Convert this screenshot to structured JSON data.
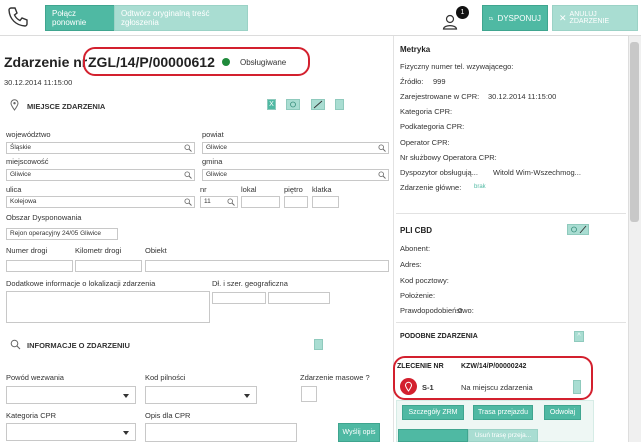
{
  "toolbar": {
    "reconnect_label": "Połącz ponownie",
    "play_original_label": "Odtwórz oryginalną treść zgłoszenia",
    "notifications_count": "1",
    "dispatch_label": "DYSPONUJ",
    "cancel_call_label": "ANULUJ ZDARZENIE"
  },
  "incident": {
    "title_prefix": "Zdarzenie nr",
    "number": "ZGL/14/P/00000612",
    "status": "Obsługiwane",
    "datetime": "30.12.2014 11:15:00"
  },
  "location": {
    "section_title": "MIEJSCE ZDARZENIA",
    "voivodeship_label": "województwo",
    "voivodeship_value": "Śląskie",
    "county_label": "powiat",
    "county_value": "Gliwice",
    "city_label": "miejscowość",
    "city_value": "Gliwice",
    "commune_label": "gmina",
    "commune_value": "Gliwice",
    "street_label": "ulica",
    "street_value": "Kolejowa",
    "number_label": "nr",
    "number_value": "11",
    "apartment_label": "lokal",
    "floor_label": "piętro",
    "stairwell_label": "klatka",
    "dispatch_area_label": "Obszar Dysponowania",
    "dispatch_area_value": "Rejon operacyjny 24/05 Gliwice",
    "road_number_label": "Numer drogi",
    "road_km_label": "Kilometr drogi",
    "object_label": "Obiekt",
    "extra_info_label": "Dodatkowe informacje o lokalizacji zdarzenia",
    "geo_label": "Dł. i szer. geograficzna"
  },
  "event_info": {
    "section_title": "INFORMACJE O ZDARZENIU",
    "reason_label": "Powód wezwania",
    "urgency_label": "Kod pilności",
    "mass_event_label": "Zdarzenie masowe ?",
    "cpr_category_label": "Kategoria CPR",
    "cpr_description_label": "Opis dla CPR",
    "send_description_label": "Wyślij opis"
  },
  "metrics": {
    "title": "Metryka",
    "phone_label": "Fizyczny numer tel. wzywającego:",
    "source_label": "Źródło:",
    "source_value": "999",
    "cpr_registered_label": "Zarejestrowane w CPR:",
    "cpr_registered_value": "30.12.2014 11:15:00",
    "cpr_category_label": "Kategoria CPR:",
    "cpr_subcategory_label": "Podkategoria CPR:",
    "cpr_operator_label": "Operator CPR:",
    "cpr_operator_id_label": "Nr służbowy Operatora CPR:",
    "dispatcher_label": "Dyspozytor obsługują...",
    "dispatcher_value": "Witold Wim-Wszechmog...",
    "main_event_label": "Zdarzenie główne:",
    "main_event_value": "brak"
  },
  "pli": {
    "title": "PLI CBD",
    "subscriber_label": "Abonent:",
    "address_label": "Adres:",
    "postal_label": "Kod pocztowy:",
    "position_label": "Położenie:",
    "probability_label": "Prawdopodobieństwo:",
    "probability_value": "0"
  },
  "similar": {
    "title": "PODOBNE ZDARZENIA"
  },
  "order": {
    "label": "ZLECENIE NR",
    "number": "KZW/14/P/00000242",
    "unit": "S-1",
    "status": "Na miejscu zdarzenia",
    "details_label": "Szczegóły ZRM",
    "route_label": "Trasa przejazdu",
    "recall_label": "Odwołaj",
    "remove_route_label": "Usuń trasę przeja..."
  },
  "colors": {
    "accent": "#4fb9a3",
    "accent_light": "#a9ddd2",
    "highlight": "#d3202e",
    "status_ok": "#1f8a3b"
  }
}
